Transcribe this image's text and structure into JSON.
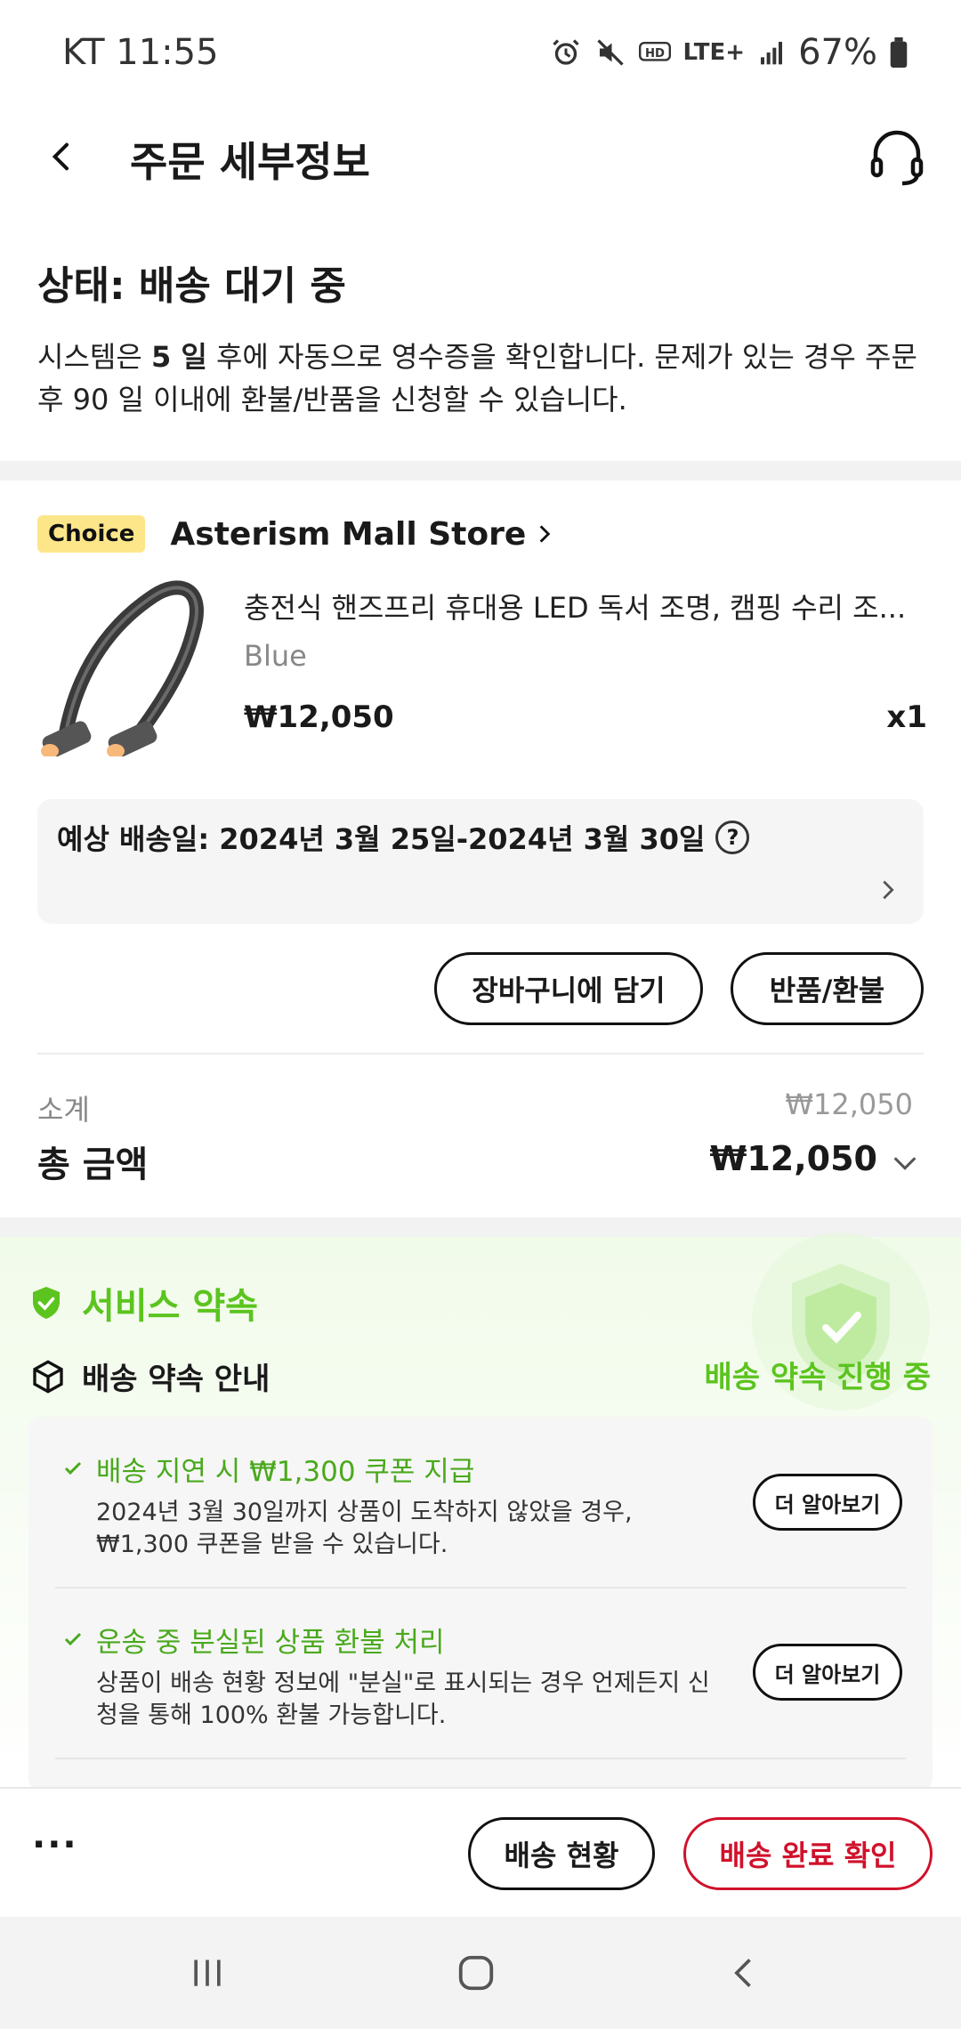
{
  "statusbar": {
    "carrier_time": "KT 11:55",
    "network": "LTE+",
    "battery": "67%"
  },
  "header": {
    "title": "주문 세부정보"
  },
  "order_status": {
    "title": "상태: 배송 대기 중",
    "desc_prefix": "시스템은 ",
    "desc_bold": "5 일",
    "desc_suffix": " 후에 자동으로 영수증을 확인합니다. 문제가 있는 경우 주문 후 90 일 이내에 환불/반품을 신청할 수 있습니다."
  },
  "store": {
    "badge": "Choice",
    "name": "Asterism Mall Store"
  },
  "product": {
    "title": "충전식 핸즈프리 휴대용 LED 독서 조명, 캠핑 수리 조...",
    "variant": "Blue",
    "price": "₩12,050",
    "quantity": "x1"
  },
  "delivery": {
    "estimate": "예상 배송일: 2024년 3월 25일-2024년 3월 30일"
  },
  "actions": {
    "add_to_cart": "장바구니에 담기",
    "return_refund": "반품/환불"
  },
  "summary": {
    "subtotal_label": "소계",
    "subtotal_value": "₩12,050",
    "total_label": "총 금액",
    "total_value": "₩12,050"
  },
  "service": {
    "title": "서비스 약속",
    "promise_label": "배송 약속 안내",
    "promise_status": "배송 약속 진행 중",
    "items": [
      {
        "title": "배송 지연 시 ₩1,300 쿠폰 지급",
        "desc": "2024년 3월 30일까지 상품이 도착하지 않았을 경우, ₩1,300 쿠폰을 받을 수 있습니다.",
        "button": "더 알아보기"
      },
      {
        "title": "운송 중 분실된 상품 환불 처리",
        "desc": "상품이 배송 현황 정보에 \"분실\"로 표시되는 경우 언제든지 신청을 통해 100% 환불 가능합니다.",
        "button": "더 알아보기"
      }
    ]
  },
  "bottom_bar": {
    "more": "···",
    "tracking": "배송 현황",
    "confirm": "배송 완료 확인"
  },
  "colors": {
    "accent_green": "#5bc41e",
    "confirm_red": "#d0112b",
    "choice_badge": "#fde68a"
  },
  "icons": {
    "header_back": "chevron-left-icon",
    "header_support": "headset-icon",
    "service": "shield-check-icon",
    "promise": "box-icon"
  }
}
